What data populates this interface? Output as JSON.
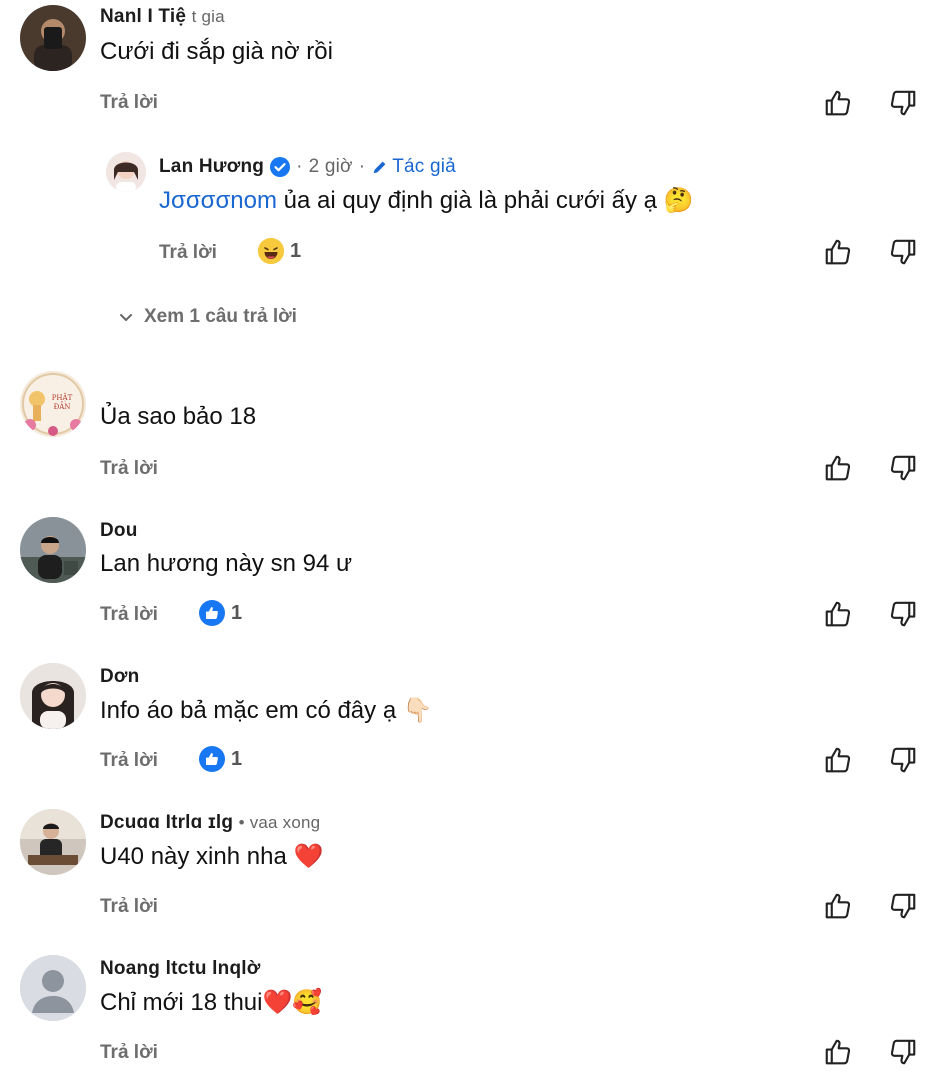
{
  "comments": [
    {
      "name": "Nanl I Tiệ",
      "name_extra": "t gia",
      "text": "Cưới đi sắp già nờ rồi",
      "reply_label": "Trả lời"
    },
    {
      "name": "Lan Hương",
      "time": "2 giờ",
      "author_label": "Tác giả",
      "mention": "Jσσσσnom",
      "text": "ủa ai quy định già là phải cưới ấy ạ",
      "emoji": "🤔",
      "reply_label": "Trả lời",
      "reaction_count": "1"
    },
    {
      "text": "Ủa sao bảo 18",
      "reply_label": "Trả lời"
    },
    {
      "name": "Dou",
      "text": "Lan hương này sn 94 ư",
      "reply_label": "Trả lời",
      "reaction_count": "1"
    },
    {
      "name": "Dơn",
      "text": "Info áo bả mặc em có đây ạ",
      "emoji": "👇🏻",
      "reply_label": "Trả lời",
      "reaction_count": "1"
    },
    {
      "name": "Dcuɑɑ Itrlɑ  ɪlg",
      "name_extra": "• vaa xong",
      "text": "U40 này xinh nha",
      "emoji": "❤️",
      "reply_label": "Trả lời"
    },
    {
      "name": "Noang ltctu lnqlờ",
      "text": "Chỉ mới 18 thui",
      "emoji": "❤️🥰",
      "reply_label": "Trả lời"
    }
  ],
  "view_replies": "Xem 1 câu trả lời",
  "colors": {
    "accent": "#1a67d2",
    "muted": "#6d6d6d",
    "like_badge": "#1877f2"
  }
}
